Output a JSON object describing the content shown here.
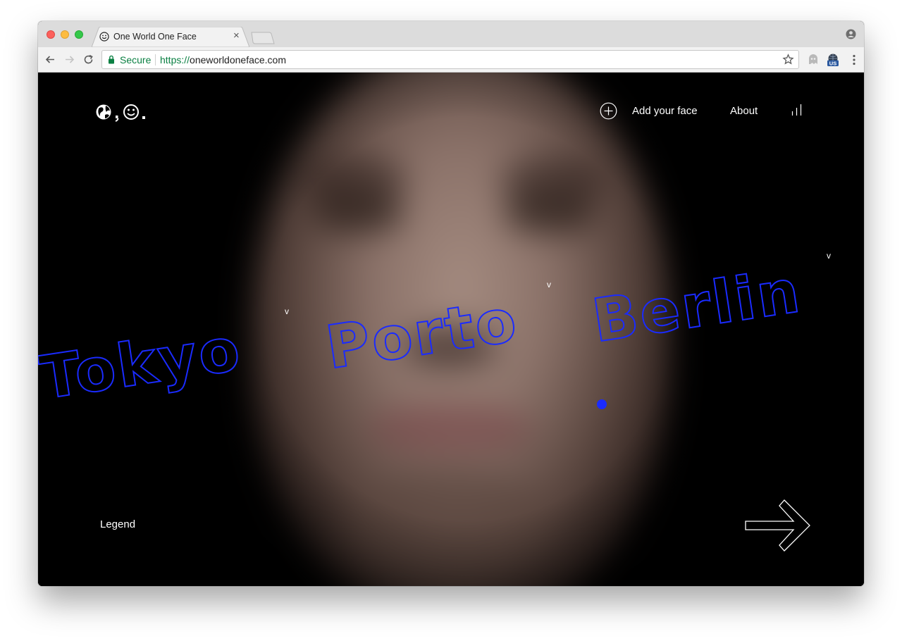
{
  "browser": {
    "tab_title": "One World One Face",
    "tab_close": "×",
    "secure_label": "Secure",
    "url_scheme": "https://",
    "url_host": "oneworldoneface.com",
    "extension_badge": "US"
  },
  "site": {
    "logo": "🌍,☺.",
    "nav": {
      "add_face_label": "Add your face",
      "about_label": "About"
    },
    "cities": [
      "Tokyo",
      "Porto",
      "Berlin"
    ],
    "city_caret": "v",
    "legend_label": "Legend",
    "colors": {
      "accent": "#1a2bff",
      "text": "#ffffff",
      "background": "#000000"
    }
  }
}
